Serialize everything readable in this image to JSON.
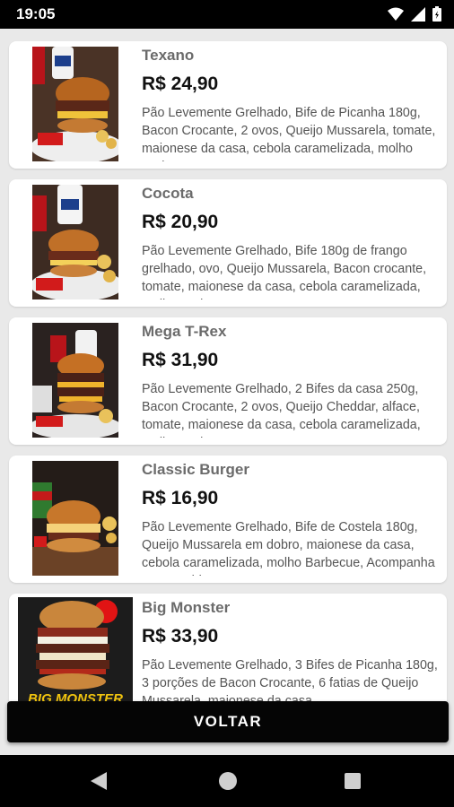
{
  "status_bar": {
    "time": "19:05",
    "icons": [
      "wifi-icon",
      "signal-icon",
      "battery-icon"
    ]
  },
  "products": [
    {
      "name": "Texano",
      "price": "R$ 24,90",
      "description": "Pão Levemente Grelhado, Bife de Picanha 180g, Bacon Crocante, 2 ovos, Queijo Mussarela, tomate, maionese da casa, cebola caramelizada, molho Barbecue"
    },
    {
      "name": "Cocota",
      "price": "R$ 20,90",
      "description": "Pão Levemente Grelhado, Bife 180g de frango grelhado, ovo, Queijo Mussarela, Bacon crocante, tomate, maionese da casa, cebola caramelizada, molho Barbecue"
    },
    {
      "name": "Mega T-Rex",
      "price": "R$ 31,90",
      "description": "Pão Levemente Grelhado, 2 Bifes da casa 250g, Bacon Crocante, 2 ovos, Queijo Cheddar, alface, tomate, maionese da casa, cebola caramelizada, molho Barbecue"
    },
    {
      "name": "Classic Burger",
      "price": "R$ 16,90",
      "description": "Pão Levemente Grelhado, Bife de Costela 180g, Queijo Mussarela em dobro, maionese da casa, cebola caramelizada, molho Barbecue, Acompanha Batata Chips"
    },
    {
      "name": "Big Monster",
      "price": "R$ 33,90",
      "description": "Pão Levemente Grelhado, 3 Bifes de Picanha 180g, 3 porções de Bacon Crocante, 6 fatias de Queijo Mussarela, maionese da casa"
    }
  ],
  "image_text": {
    "big_monster_logo": "BIG MONSTER"
  },
  "voltar_label": "VOLTAR",
  "nav": {
    "back": "back-icon",
    "home": "home-icon",
    "recents": "recents-icon"
  }
}
